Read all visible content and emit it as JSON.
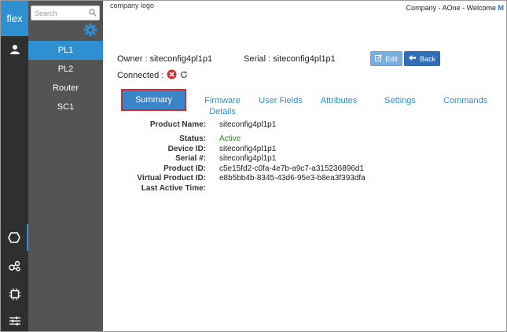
{
  "brand": {
    "label": "flex"
  },
  "header": {
    "logo_text": "company logo",
    "welcome_text": "Company - AOne - Welcome ",
    "welcome_user": "M"
  },
  "sidebar": {
    "search_placeholder": "Search",
    "items": [
      {
        "label": "PL1",
        "active": true
      },
      {
        "label": "PL2",
        "active": false
      },
      {
        "label": "Router",
        "active": false
      },
      {
        "label": "SC1",
        "active": false
      }
    ]
  },
  "device": {
    "owner_label": "Owner : siteconfig4pl1p1",
    "serial_label": "Serial : siteconfig4pl1p1",
    "connected_label": "Connected :"
  },
  "buttons": {
    "edit": "Edit",
    "back": "Back"
  },
  "tabs": [
    {
      "label": "Summary",
      "active": true
    },
    {
      "label": "Firmware",
      "label2": "Details"
    },
    {
      "label": "User Fields"
    },
    {
      "label": "Attributes"
    },
    {
      "label": "Settings"
    },
    {
      "label": "Commands"
    }
  ],
  "summary": [
    {
      "key": "Product Name:",
      "value": "siteconfig4pl1p1"
    },
    {
      "key": "Status:",
      "value": "Active"
    },
    {
      "key": "Device ID:",
      "value": "siteconfig4pl1p1"
    },
    {
      "key": "Serial #:",
      "value": "siteconfig4pl1p1"
    },
    {
      "key": "Product ID:",
      "value": "c5e15fd2-c0fa-4e7b-a9c7-a315236896d1"
    },
    {
      "key": "Virtual Product ID:",
      "value": "e8b5bb4b-8345-43d6-95e3-b8ea3f393dfa"
    },
    {
      "key": "Last Active Time:",
      "value": ""
    }
  ],
  "colors": {
    "accent": "#2e8fd1",
    "status_active": "#2a8a2a",
    "disconnected": "#d62b2b"
  }
}
